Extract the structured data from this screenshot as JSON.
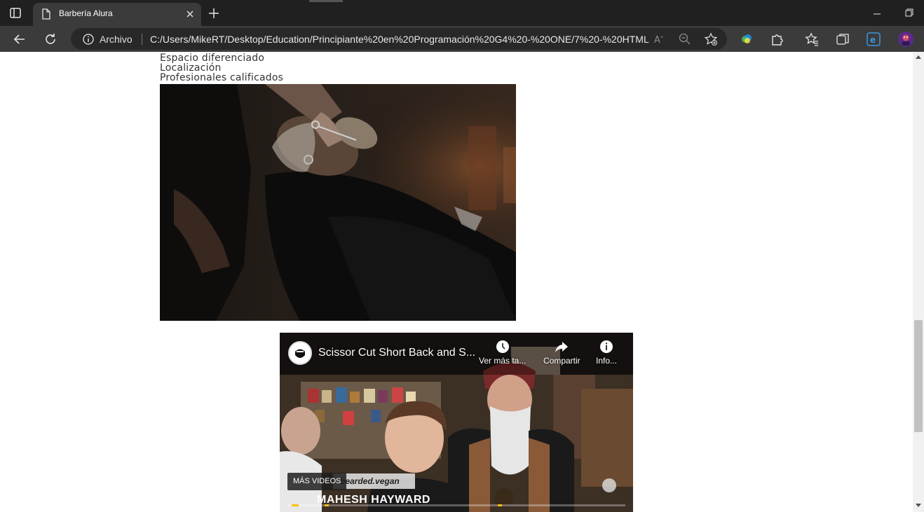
{
  "tab": {
    "title": "Barbería Alura"
  },
  "address_bar": {
    "scheme_label": "Archivo",
    "url": "C:/Users/MikeRT/Desktop/Education/Principiante%20en%20Programación%20G4%20-%20ONE/7%20-%20HTML..."
  },
  "page": {
    "list_items": [
      "Espacio diferenciado",
      "Localización",
      "Profesionales calificados"
    ]
  },
  "video": {
    "title": "Scissor Cut Short Back and S...",
    "watch_later_label": "Ver más ta...",
    "share_label": "Compartir",
    "info_label": "Info...",
    "more_videos_label": "MÁS VIDEOS",
    "channel_handle": "bearded.vegan",
    "nameplate": "MAHESH HAYWARD",
    "accent_color": "#f9c10e"
  },
  "icons": {
    "tab_actions": "tab-actions-icon",
    "page": "page-icon",
    "close": "close-icon",
    "new_tab": "plus-icon",
    "back": "back-arrow-icon",
    "refresh": "refresh-icon",
    "info": "info-icon",
    "read_aloud": "read-aloud-icon",
    "zoom": "zoom-out-icon",
    "favorite_add": "add-favorite-icon",
    "extensions": "puzzle-icon",
    "favorites": "favorites-icon",
    "collections": "collections-icon",
    "edge": "edge-icon",
    "profile": "profile-avatar"
  }
}
